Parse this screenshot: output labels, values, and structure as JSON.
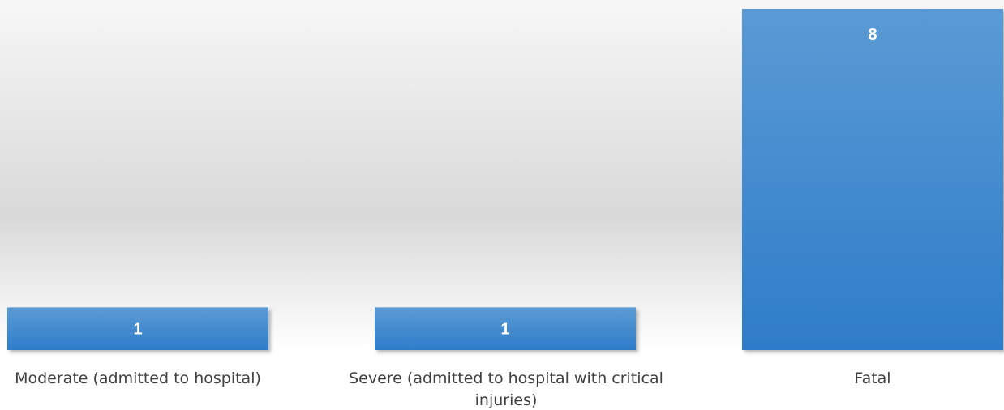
{
  "chart_data": {
    "type": "bar",
    "categories": [
      [
        "Moderate (admitted to hospital)"
      ],
      [
        "Severe (admitted to hospital with critical",
        "injuries)"
      ],
      [
        "Fatal"
      ]
    ],
    "values": [
      1,
      1,
      8
    ],
    "data_labels": [
      "1",
      "1",
      "8"
    ],
    "ylim": [
      0,
      8
    ],
    "grid": false,
    "legend": "none",
    "colors": {
      "bar_top": "#5b9bd5",
      "bar_bottom": "#2e7cc9",
      "value_text": "#ffffff",
      "category_text": "#404040",
      "bg_top": "#f7f7f7",
      "bg_mid": "#d9d9d9",
      "bg_bottom": "#ffffff"
    }
  }
}
